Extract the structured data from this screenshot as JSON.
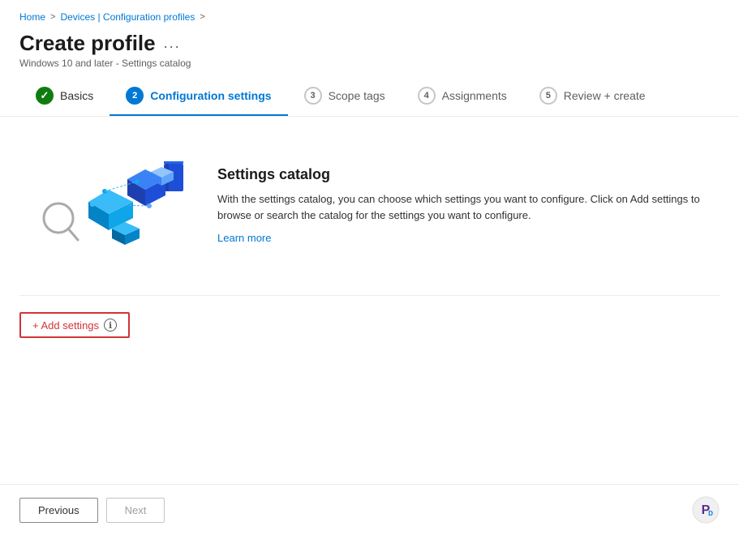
{
  "breadcrumb": {
    "home": "Home",
    "sep1": ">",
    "devices": "Devices | Configuration profiles",
    "sep2": ">"
  },
  "header": {
    "title": "Create profile",
    "dots": "...",
    "subtitle": "Windows 10 and later - Settings catalog"
  },
  "tabs": [
    {
      "id": "basics",
      "number": "✓",
      "label": "Basics",
      "state": "completed"
    },
    {
      "id": "configuration",
      "number": "2",
      "label": "Configuration settings",
      "state": "active"
    },
    {
      "id": "scopetags",
      "number": "3",
      "label": "Scope tags",
      "state": "inactive"
    },
    {
      "id": "assignments",
      "number": "4",
      "label": "Assignments",
      "state": "inactive"
    },
    {
      "id": "review",
      "number": "5",
      "label": "Review + create",
      "state": "inactive"
    }
  ],
  "main": {
    "catalog_heading": "Settings catalog",
    "catalog_description": "With the settings catalog, you can choose which settings you want to configure. Click on Add settings to browse or search the catalog for the settings you want to configure.",
    "learn_more": "Learn more",
    "add_settings_label": "+ Add settings",
    "info_icon_label": "ℹ"
  },
  "footer": {
    "previous_label": "Previous",
    "next_label": "Next"
  },
  "colors": {
    "active_blue": "#0078d4",
    "completed_green": "#107c10",
    "error_red": "#d13438",
    "text_primary": "#323130",
    "text_secondary": "#605e5c"
  }
}
